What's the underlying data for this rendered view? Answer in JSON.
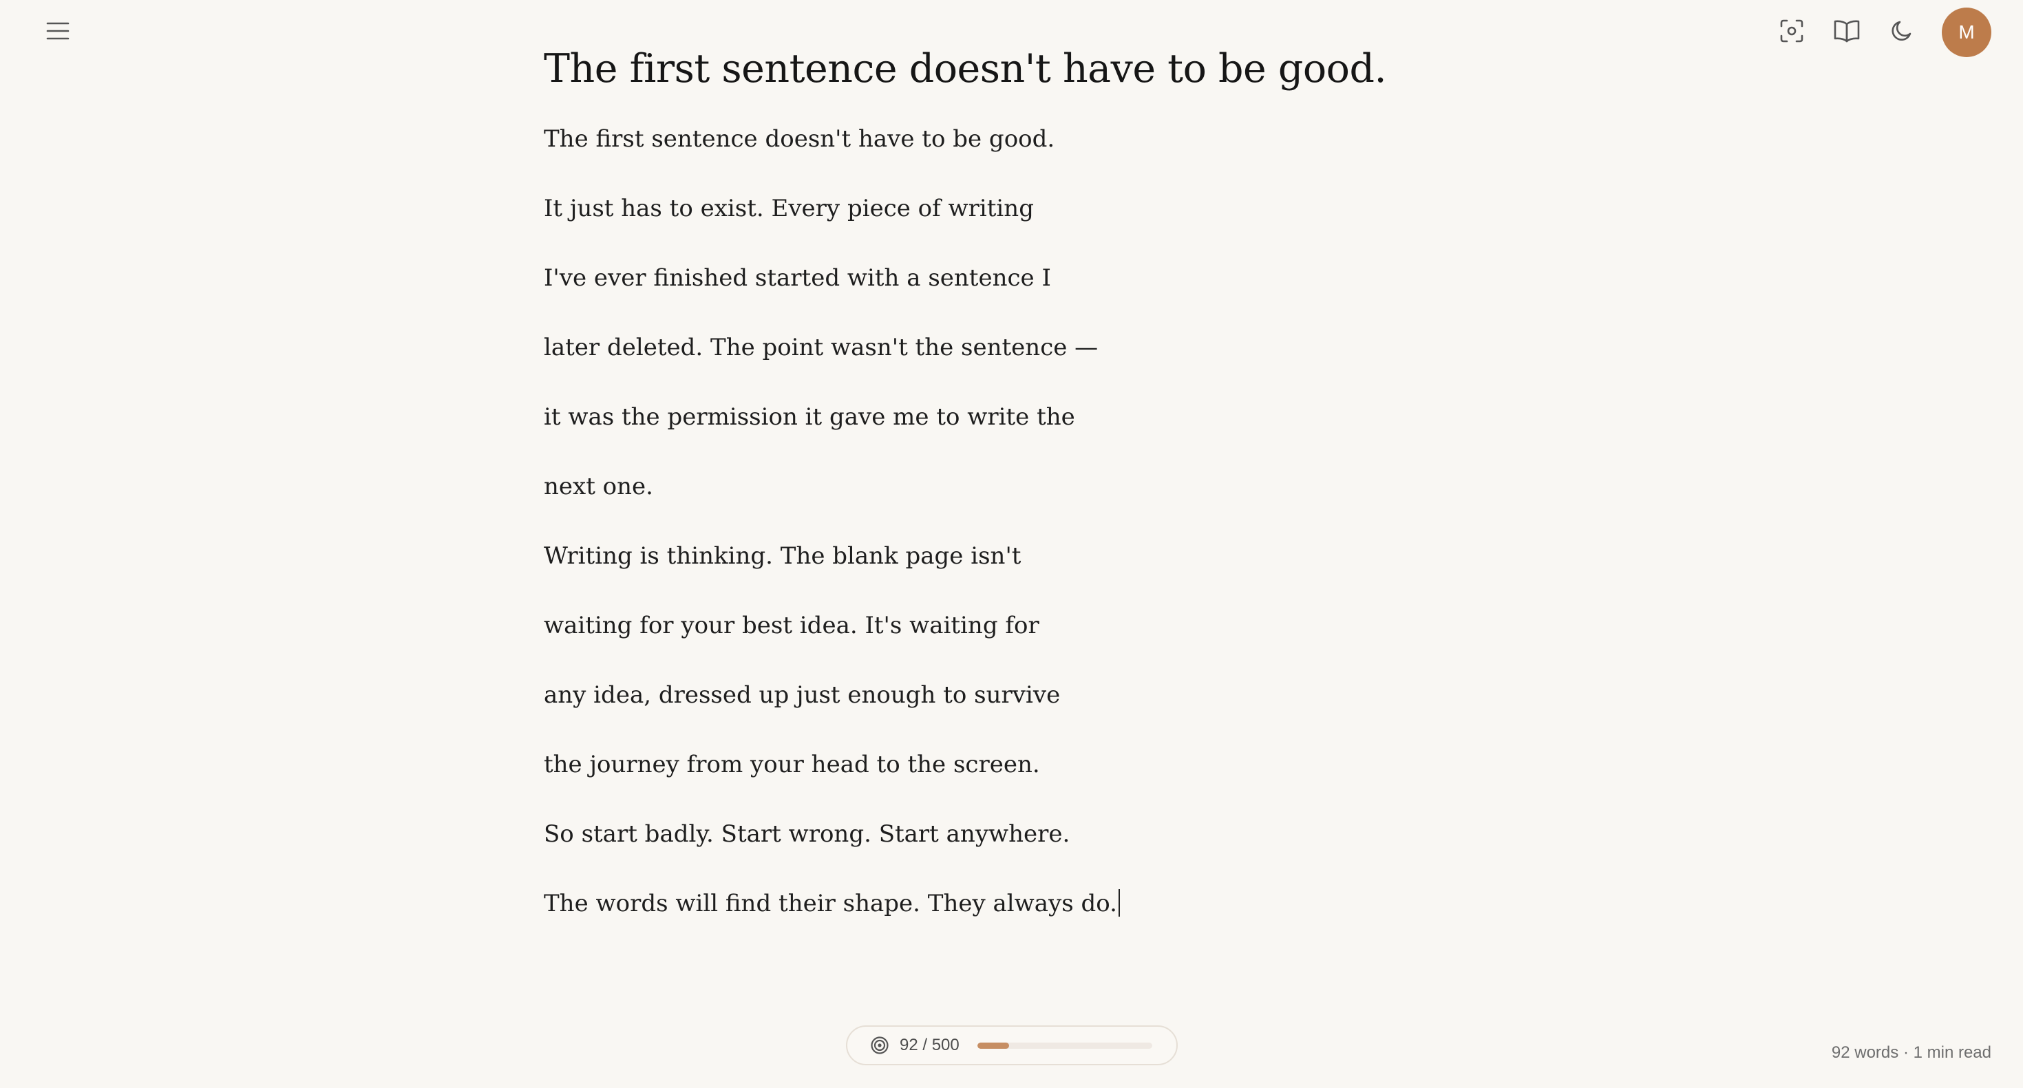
{
  "icons": {
    "menu": "menu-icon",
    "focus": "focus-icon",
    "reader": "book-icon",
    "theme": "moon-icon",
    "goal": "target-icon"
  },
  "user": {
    "initial": "M"
  },
  "document": {
    "title": "The first sentence doesn't have to be good.",
    "lines": [
      "The first sentence doesn't have to be good.",
      "It just has to exist. Every piece of writing",
      "I've ever finished started with a sentence I",
      "later deleted. The point wasn't the sentence —",
      "it was the permission it gave me to write the",
      "next one.",
      "Writing is thinking. The blank page isn't",
      "waiting for your best idea. It's waiting for",
      "any idea, dressed up just enough to survive",
      "the journey from your head to the screen.",
      "So start badly. Start wrong. Start anywhere.",
      "The words will find their shape. They always do."
    ]
  },
  "goal": {
    "label": "92 / 500",
    "current": 92,
    "target": 500
  },
  "status": {
    "text": "92 words · 1 min read"
  },
  "colors": {
    "background": "#f9f7f3",
    "accent": "#bd7c4b",
    "progress": "#c68e63"
  }
}
